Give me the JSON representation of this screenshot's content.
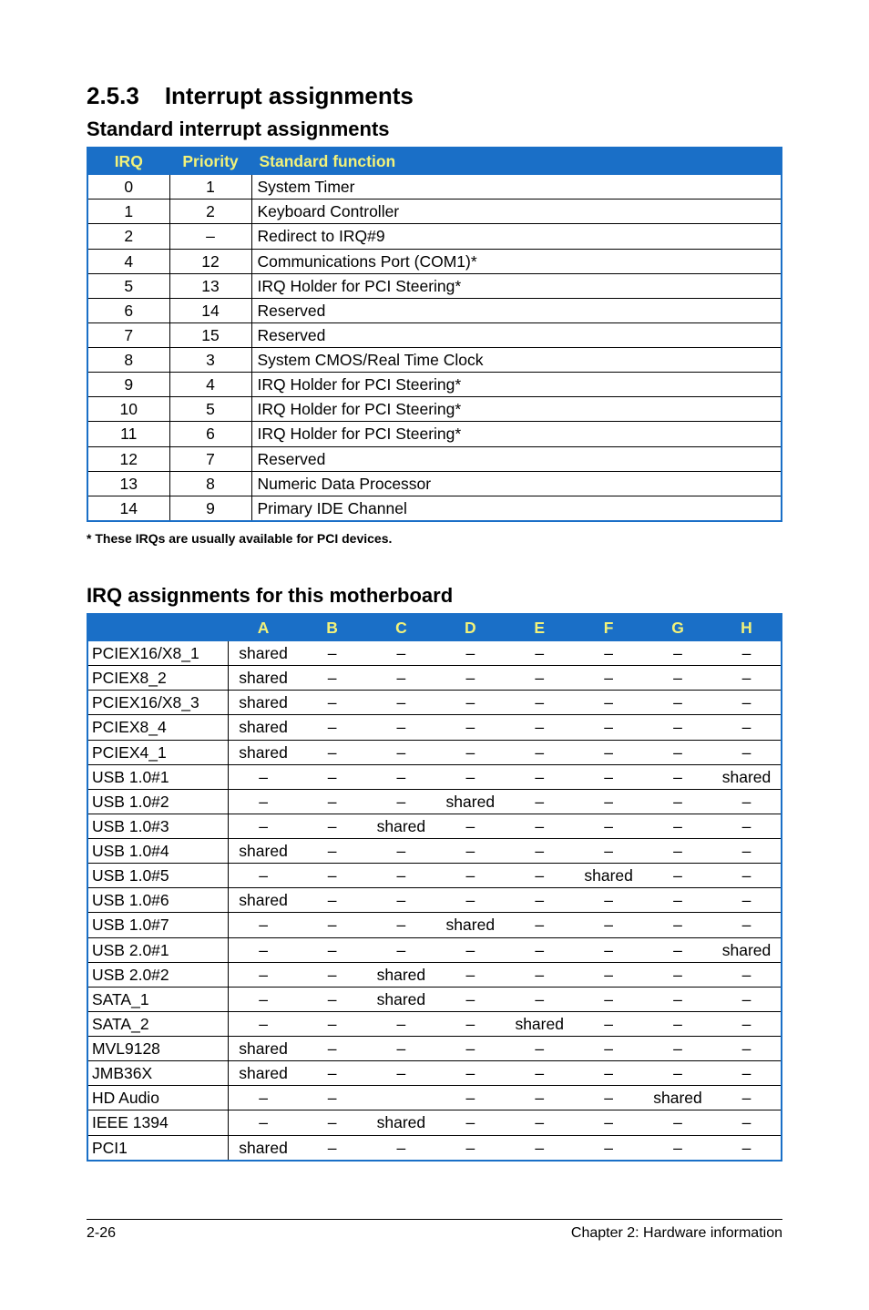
{
  "heading": {
    "num": "2.5.3",
    "title": "Interrupt assignments"
  },
  "sub1": "Standard interrupt assignments",
  "t1": {
    "headers": {
      "irq": "IRQ",
      "priority": "Priority",
      "func": "Standard function"
    },
    "rows": [
      {
        "irq": "0",
        "pri": "1",
        "func": "System Timer"
      },
      {
        "irq": "1",
        "pri": "2",
        "func": "Keyboard Controller"
      },
      {
        "irq": "2",
        "pri": "–",
        "func": "Redirect to IRQ#9"
      },
      {
        "irq": "4",
        "pri": "12",
        "func": "Communications Port (COM1)*"
      },
      {
        "irq": "5",
        "pri": "13",
        "func": "IRQ Holder for PCI Steering*"
      },
      {
        "irq": "6",
        "pri": "14",
        "func": "Reserved"
      },
      {
        "irq": "7",
        "pri": "15",
        "func": "Reserved"
      },
      {
        "irq": "8",
        "pri": "3",
        "func": "System CMOS/Real Time Clock"
      },
      {
        "irq": "9",
        "pri": "4",
        "func": "IRQ Holder for PCI Steering*"
      },
      {
        "irq": "10",
        "pri": "5",
        "func": "IRQ Holder for PCI Steering*"
      },
      {
        "irq": "11",
        "pri": "6",
        "func": "IRQ Holder for PCI Steering*"
      },
      {
        "irq": "12",
        "pri": "7",
        "func": "Reserved"
      },
      {
        "irq": "13",
        "pri": "8",
        "func": "Numeric Data Processor"
      },
      {
        "irq": "14",
        "pri": "9",
        "func": "Primary IDE Channel"
      }
    ]
  },
  "footnote": "* These IRQs are usually available for PCI devices.",
  "sub2": "IRQ assignments for this motherboard",
  "t2": {
    "headers": {
      "blank": "",
      "A": "A",
      "B": "B",
      "C": "C",
      "D": "D",
      "E": "E",
      "F": "F",
      "G": "G",
      "H": "H"
    },
    "rows": [
      {
        "label": "PCIEX16/X8_1",
        "A": "shared",
        "B": "–",
        "C": "–",
        "D": "–",
        "E": "–",
        "F": "–",
        "G": "–",
        "H": "–"
      },
      {
        "label": "PCIEX8_2",
        "A": "shared",
        "B": "–",
        "C": "–",
        "D": "–",
        "E": "–",
        "F": "–",
        "G": "–",
        "H": "–"
      },
      {
        "label": "PCIEX16/X8_3",
        "A": "shared",
        "B": "–",
        "C": "–",
        "D": "–",
        "E": "–",
        "F": "–",
        "G": "–",
        "H": "–"
      },
      {
        "label": "PCIEX8_4",
        "A": "shared",
        "B": "–",
        "C": "–",
        "D": "–",
        "E": "–",
        "F": "–",
        "G": "–",
        "H": "–"
      },
      {
        "label": "PCIEX4_1",
        "A": "shared",
        "B": "–",
        "C": "–",
        "D": "–",
        "E": "–",
        "F": "–",
        "G": "–",
        "H": "–"
      },
      {
        "label": "USB 1.0#1",
        "A": "–",
        "B": "–",
        "C": "–",
        "D": "–",
        "E": "–",
        "F": "–",
        "G": "–",
        "H": "shared"
      },
      {
        "label": "USB 1.0#2",
        "A": "–",
        "B": "–",
        "C": "–",
        "D": "shared",
        "E": "–",
        "F": "–",
        "G": "–",
        "H": "–"
      },
      {
        "label": "USB 1.0#3",
        "A": "–",
        "B": "–",
        "C": "shared",
        "D": "–",
        "E": "–",
        "F": "–",
        "G": "–",
        "H": "–"
      },
      {
        "label": "USB 1.0#4",
        "A": "shared",
        "B": "–",
        "C": "–",
        "D": "–",
        "E": "–",
        "F": "–",
        "G": "–",
        "H": "–"
      },
      {
        "label": "USB 1.0#5",
        "A": "–",
        "B": "–",
        "C": "–",
        "D": "–",
        "E": "–",
        "F": "shared",
        "G": "–",
        "H": "–"
      },
      {
        "label": "USB 1.0#6",
        "A": "shared",
        "B": "–",
        "C": "–",
        "D": "–",
        "E": "–",
        "F": "–",
        "G": "–",
        "H": "–"
      },
      {
        "label": "USB 1.0#7",
        "A": "–",
        "B": "–",
        "C": "–",
        "D": "shared",
        "E": "–",
        "F": "–",
        "G": "–",
        "H": "–"
      },
      {
        "label": "USB 2.0#1",
        "A": "–",
        "B": "–",
        "C": "–",
        "D": "–",
        "E": "–",
        "F": "–",
        "G": "–",
        "H": "shared"
      },
      {
        "label": "USB 2.0#2",
        "A": "–",
        "B": "–",
        "C": "shared",
        "D": "–",
        "E": "–",
        "F": "–",
        "G": "–",
        "H": "–"
      },
      {
        "label": "SATA_1",
        "A": "–",
        "B": "–",
        "C": "shared",
        "D": "–",
        "E": "–",
        "F": "–",
        "G": "–",
        "H": "–"
      },
      {
        "label": "SATA_2",
        "A": "–",
        "B": "–",
        "C": "–",
        "D": "–",
        "E": "shared",
        "F": "–",
        "G": "–",
        "H": "–"
      },
      {
        "label": "MVL9128",
        "A": "shared",
        "B": "–",
        "C": "–",
        "D": "–",
        "E": "–",
        "F": "–",
        "G": "–",
        "H": "–"
      },
      {
        "label": "JMB36X",
        "A": "shared",
        "B": "–",
        "C": "–",
        "D": "–",
        "E": "–",
        "F": "–",
        "G": "–",
        "H": "–"
      },
      {
        "label": "HD Audio",
        "A": "–",
        "B": "–",
        "C": "",
        "D": "–",
        "E": "–",
        "F": "–",
        "G": "shared",
        "H": "–"
      },
      {
        "label": "IEEE 1394",
        "A": "–",
        "B": "–",
        "C": "shared",
        "D": "–",
        "E": "–",
        "F": "–",
        "G": "–",
        "H": "–"
      },
      {
        "label": "PCI1",
        "A": "shared",
        "B": "–",
        "C": "–",
        "D": "–",
        "E": "–",
        "F": "–",
        "G": "–",
        "H": "–"
      }
    ]
  },
  "footer": {
    "left": "2-26",
    "right": "Chapter 2: Hardware information"
  }
}
